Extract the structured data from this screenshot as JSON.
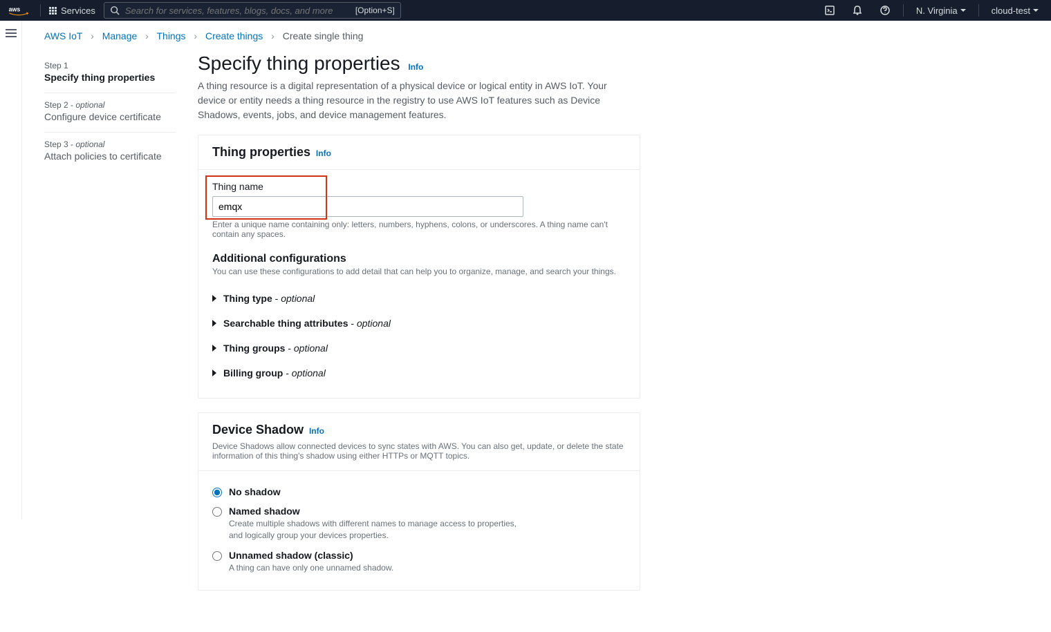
{
  "topnav": {
    "services_label": "Services",
    "search_placeholder": "Search for services, features, blogs, docs, and more",
    "search_shortcut": "[Option+S]",
    "region": "N. Virginia",
    "account": "cloud-test"
  },
  "breadcrumbs": [
    "AWS IoT",
    "Manage",
    "Things",
    "Create things",
    "Create single thing"
  ],
  "steps": [
    {
      "label": "Step 1",
      "optional": false,
      "title": "Specify thing properties",
      "active": true
    },
    {
      "label": "Step 2",
      "optional": true,
      "title": "Configure device certificate",
      "active": false
    },
    {
      "label": "Step 3",
      "optional": true,
      "title": "Attach policies to certificate",
      "active": false
    }
  ],
  "page": {
    "title": "Specify thing properties",
    "info": "Info",
    "description": "A thing resource is a digital representation of a physical device or logical entity in AWS IoT. Your device or entity needs a thing resource in the registry to use AWS IoT features such as Device Shadows, events, jobs, and device management features."
  },
  "thing_properties_panel": {
    "header": "Thing properties",
    "info": "Info",
    "name_label": "Thing name",
    "name_value": "emqx",
    "name_hint": "Enter a unique name containing only: letters, numbers, hyphens, colons, or underscores. A thing name can't contain any spaces.",
    "additional_header": "Additional configurations",
    "additional_desc": "You can use these configurations to add detail that can help you to organize, manage, and search your things.",
    "optional_word": "optional",
    "expandables": [
      {
        "label": "Thing type"
      },
      {
        "label": "Searchable thing attributes"
      },
      {
        "label": "Thing groups"
      },
      {
        "label": "Billing group"
      }
    ]
  },
  "device_shadow_panel": {
    "header": "Device Shadow",
    "info": "Info",
    "desc": "Device Shadows allow connected devices to sync states with AWS. You can also get, update, or delete the state information of this thing's shadow using either HTTPs or MQTT topics.",
    "options": [
      {
        "label": "No shadow",
        "desc": "",
        "checked": true
      },
      {
        "label": "Named shadow",
        "desc": "Create multiple shadows with different names to manage access to properties, and logically group your devices properties.",
        "checked": false
      },
      {
        "label": "Unnamed shadow (classic)",
        "desc": "A thing can have only one unnamed shadow.",
        "checked": false
      }
    ]
  }
}
